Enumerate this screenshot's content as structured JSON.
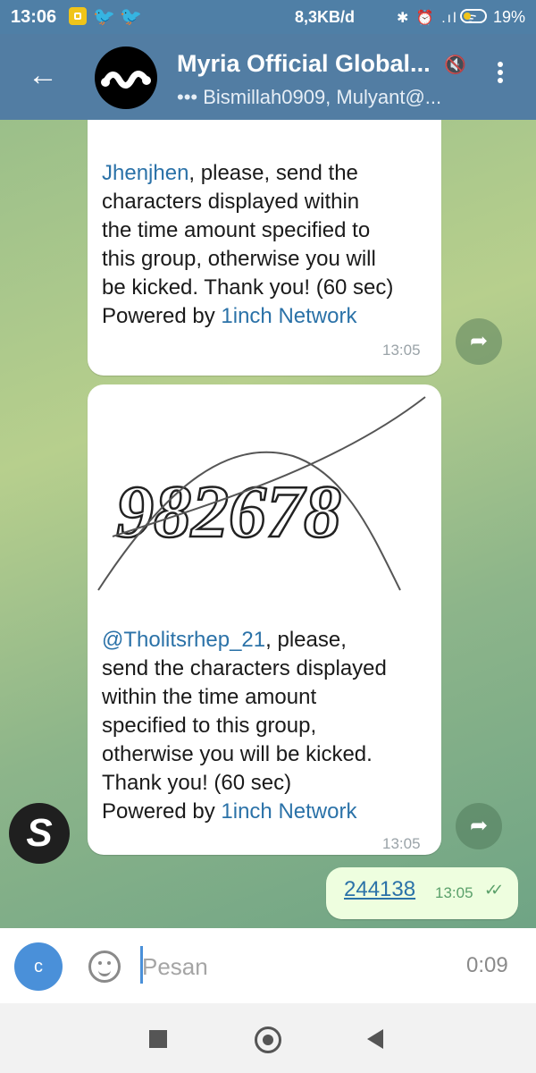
{
  "statusbar": {
    "time": "13:06",
    "network_speed": "8,3KB/d",
    "status_icons": "✱ ⏰ .ıl ᯤ",
    "battery_percent": "19%"
  },
  "header": {
    "title": "Myria Official Global...",
    "subtitle": "••• Bismillah0909, Mulyant@..."
  },
  "messages": [
    {
      "mention": "Jhenjhen",
      "lines": [
        ", please, send the",
        "characters displayed within",
        "the time amount specified to",
        "this group, otherwise you will",
        "be kicked. Thank you! (60 sec)"
      ],
      "powered_prefix": "Powered by ",
      "powered_link": "1inch Network",
      "time": "13:05"
    },
    {
      "captcha_text": "982678",
      "mention": "@Tholitsrhep_21",
      "lines": [
        ", please,",
        "send the characters displayed",
        "within the time amount",
        "specified to this group,",
        "otherwise you will be kicked.",
        "Thank you! (60 sec)"
      ],
      "powered_prefix": "Powered by ",
      "powered_link": "1inch Network",
      "time": "13:05"
    }
  ],
  "outgoing": {
    "text": "244138",
    "time": "13:05"
  },
  "input": {
    "attach_label": "c",
    "placeholder": "Pesan",
    "timer": "0:09"
  },
  "avatar_letter": "S",
  "colors": {
    "header": "#527da3",
    "mention": "#2b72a8",
    "outgoing_bubble": "#eefedf"
  }
}
